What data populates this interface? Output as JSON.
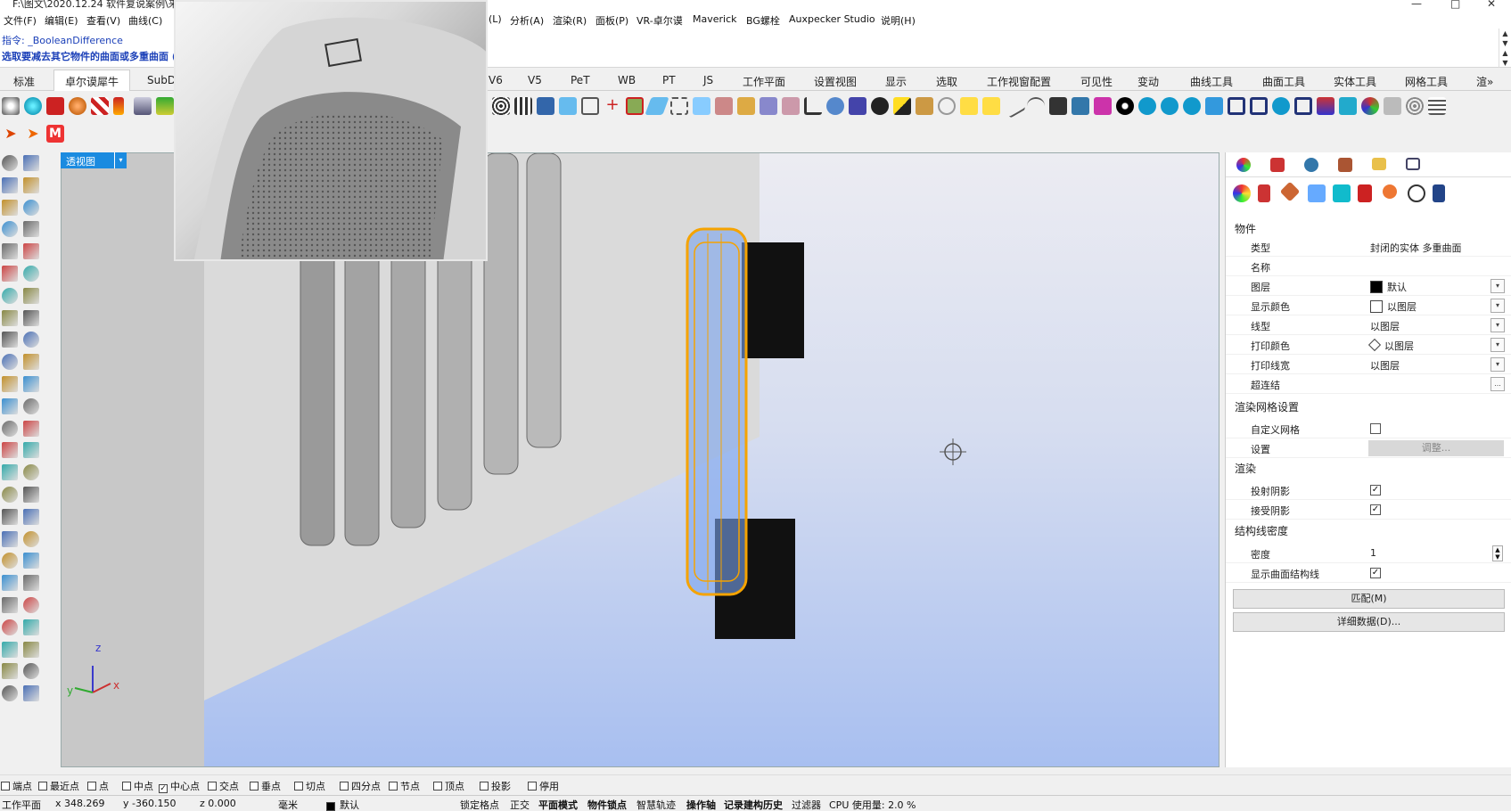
{
  "window": {
    "title": "F:\\图文\\2020.12.24 软件复说案例\\来",
    "minimize": "—",
    "maximize": "□",
    "close": "✕"
  },
  "menu": [
    "文件(F)",
    "编辑(E)",
    "查看(V)",
    "曲线(C)",
    "(L)",
    "分析(A)",
    "渲染(R)",
    "面板(P)",
    "VR-卓尔谟",
    "Maverick",
    "BG螺栓",
    "Auxpecker Studio",
    "说明(H)"
  ],
  "command": {
    "line1": "指令: _BooleanDifference",
    "line2": "选取要减去其它物件的曲面或多重曲面 (  "
  },
  "tabs": [
    "标准",
    "卓尔谟犀牛",
    "SubD",
    "V6",
    "V5",
    "PeT",
    "WB",
    "PT",
    "JS",
    "工作平面",
    "设置视图",
    "显示",
    "选取",
    "工作视窗配置",
    "可见性",
    "变动",
    "曲线工具",
    "曲面工具",
    "实体工具",
    "网格工具",
    "渲»"
  ],
  "active_tab": "卓尔谟犀牛",
  "viewport": {
    "label": "透视图",
    "dropdown": "▾",
    "axis": {
      "z": "z",
      "y": "y",
      "x": "x"
    }
  },
  "properties": {
    "section_object": "物件",
    "rows": [
      {
        "k": "类型",
        "v": "封闭的实体 多重曲面"
      },
      {
        "k": "名称",
        "v": ""
      },
      {
        "k": "图层",
        "v": "默认",
        "swatch": "#000000",
        "dropdown": true
      },
      {
        "k": "显示颜色",
        "v": "以图层",
        "swatch": "#ffffff",
        "dropdown": true
      },
      {
        "k": "线型",
        "v": "以图层",
        "dropdown": true
      },
      {
        "k": "打印颜色",
        "v": "以图层",
        "diamond": true,
        "dropdown": true
      },
      {
        "k": "打印线宽",
        "v": "以图层",
        "dropdown": true
      },
      {
        "k": "超连结",
        "v": "",
        "ellipsis": "..."
      }
    ],
    "section_mesh": "渲染网格设置",
    "mesh_rows": [
      {
        "k": "自定义网格",
        "checked": false
      },
      {
        "k": "设置",
        "button": "调整..."
      }
    ],
    "section_render": "渲染",
    "render_rows": [
      {
        "k": "投射阴影",
        "checked": true
      },
      {
        "k": "接受阴影",
        "checked": true
      }
    ],
    "section_iso": "结构线密度",
    "iso_rows": [
      {
        "k": "密度",
        "v": "1"
      },
      {
        "k": "显示曲面结构线",
        "checked": true
      }
    ],
    "btn_match": "匹配(M)",
    "btn_details": "详细数据(D)..."
  },
  "osnap": [
    {
      "label": "端点",
      "checked": false
    },
    {
      "label": "最近点",
      "checked": false
    },
    {
      "label": "点",
      "checked": false
    },
    {
      "label": "中点",
      "checked": false
    },
    {
      "label": "中心点",
      "checked": true
    },
    {
      "label": "交点",
      "checked": false
    },
    {
      "label": "垂点",
      "checked": false
    },
    {
      "label": "切点",
      "checked": false
    },
    {
      "label": "四分点",
      "checked": false
    },
    {
      "label": "节点",
      "checked": false
    },
    {
      "label": "顶点",
      "checked": false
    },
    {
      "label": "投影",
      "checked": false
    },
    {
      "label": "停用",
      "checked": false
    }
  ],
  "status": {
    "cplane": "工作平面",
    "x": "x 348.269",
    "y": "y -360.150",
    "z": "z 0.000",
    "unit": "毫米",
    "layer": "默认",
    "toggles": [
      "锁定格点",
      "正交",
      "平面模式",
      "物件锁点",
      "智慧轨迹",
      "操作轴",
      "记录建构历史",
      "过滤器"
    ],
    "bold_toggles": [
      "平面模式",
      "物件锁点",
      "操作轴",
      "记录建构历史"
    ],
    "cpu": "CPU 使用量: 2.0 %"
  },
  "colors": {
    "accent": "#1b8be0",
    "selection": "#f5a300",
    "viewport_bottom": "#a8bff0"
  }
}
